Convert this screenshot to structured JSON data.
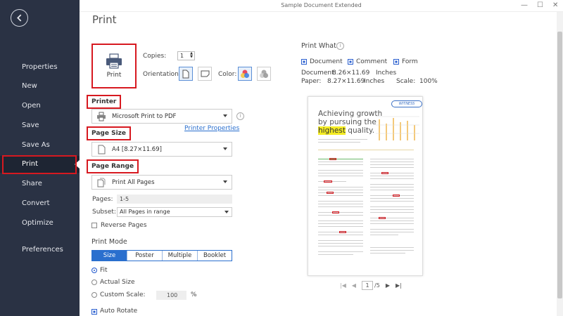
{
  "window": {
    "title": "Sample Document Extended"
  },
  "page_title": "Print",
  "sidebar": {
    "items": [
      {
        "label": "Properties"
      },
      {
        "label": "New"
      },
      {
        "label": "Open"
      },
      {
        "label": "Save"
      },
      {
        "label": "Save As"
      },
      {
        "label": "Print"
      },
      {
        "label": "Share"
      },
      {
        "label": "Convert"
      },
      {
        "label": "Optimize"
      },
      {
        "label": "Preferences"
      }
    ],
    "active": "Print"
  },
  "print_button": {
    "label": "Print"
  },
  "copies": {
    "label": "Copies:",
    "value": "1"
  },
  "orientation": {
    "label": "Orientation:"
  },
  "color": {
    "label": "Color:"
  },
  "printer": {
    "heading": "Printer",
    "selected": "Microsoft Print to PDF",
    "properties_link": "Printer Properties"
  },
  "page_size": {
    "heading": "Page Size",
    "selected": "A4 [8.27×11.69]"
  },
  "page_range": {
    "heading": "Page Range",
    "selected": "Print All Pages",
    "pages_label": "Pages:",
    "pages_value": "1-5",
    "subset_label": "Subset:",
    "subset_value": "All Pages in range",
    "reverse_label": "Reverse Pages"
  },
  "print_mode": {
    "heading": "Print Mode",
    "tabs": [
      "Size",
      "Poster",
      "Multiple",
      "Booklet"
    ],
    "active_tab": "Size",
    "fit_label": "Fit",
    "actual_size_label": "Actual Size",
    "custom_scale_label": "Custom Scale:",
    "custom_scale_value": "100",
    "percent": "%",
    "auto_rotate_label": "Auto Rotate"
  },
  "print_what": {
    "heading": "Print What",
    "options": [
      "Document",
      "Comment",
      "Form"
    ],
    "document_label": "Document:",
    "document_size": "8.26×11.69",
    "document_unit": "Inches",
    "paper_label": "Paper:",
    "paper_size": "8.27×11.69",
    "paper_unit": "Inches",
    "scale_label": "Scale:",
    "scale_value": "100%"
  },
  "preview": {
    "title_line1": "Achieving growth",
    "title_line2": "by pursuing the",
    "title_hl": "highest",
    "title_end": " quality.",
    "stamp": "WITNESS"
  },
  "pager": {
    "current": "1",
    "total": "/5"
  },
  "colors": {
    "sidebar_bg": "#2a3244",
    "accent_blue": "#2a6fce",
    "annotation_red": "#d71920"
  }
}
